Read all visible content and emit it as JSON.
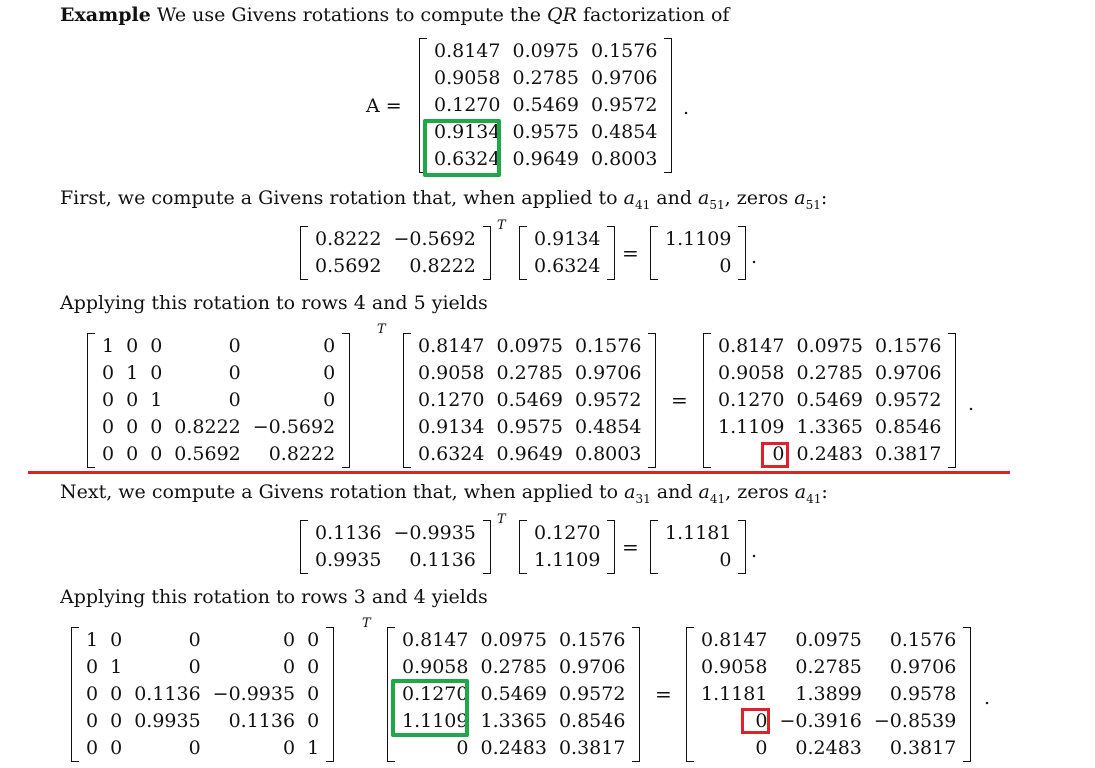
{
  "intro": {
    "bold": "Example",
    "text": " We use Givens rotations to compute the ",
    "qr": "QR",
    "tail": " factorization of"
  },
  "A": {
    "label": "A =",
    "rows": [
      [
        "0.8147",
        "0.0975",
        "0.1576"
      ],
      [
        "0.9058",
        "0.2785",
        "0.9706"
      ],
      [
        "0.1270",
        "0.5469",
        "0.9572"
      ],
      [
        "0.9134",
        "0.9575",
        "0.4854"
      ],
      [
        "0.6324",
        "0.9649",
        "0.8003"
      ]
    ]
  },
  "step1": {
    "text": "First, we compute a Givens rotation that, when applied to ",
    "a1": "a",
    "s1": "41",
    "mid": " and ",
    "a2": "a",
    "s2": "51",
    "tail": ", zeros ",
    "a3": "a",
    "s3": "51",
    "end": ":"
  },
  "g1": {
    "G": [
      [
        "0.8222",
        "−0.5692"
      ],
      [
        "0.5692",
        "0.8222"
      ]
    ],
    "v": [
      "0.9134",
      "0.6324"
    ],
    "r": [
      "1.1109",
      "0"
    ]
  },
  "apply1": "Applying this rotation to rows 4 and 5 yields",
  "eq1": {
    "Q": [
      [
        "1",
        "0",
        "0",
        "0",
        "0"
      ],
      [
        "0",
        "1",
        "0",
        "0",
        "0"
      ],
      [
        "0",
        "0",
        "1",
        "0",
        "0"
      ],
      [
        "0",
        "0",
        "0",
        "0.8222",
        "−0.5692"
      ],
      [
        "0",
        "0",
        "0",
        "0.5692",
        "0.8222"
      ]
    ],
    "A": [
      [
        "0.8147",
        "0.0975",
        "0.1576"
      ],
      [
        "0.9058",
        "0.2785",
        "0.9706"
      ],
      [
        "0.1270",
        "0.5469",
        "0.9572"
      ],
      [
        "0.9134",
        "0.9575",
        "0.4854"
      ],
      [
        "0.6324",
        "0.9649",
        "0.8003"
      ]
    ],
    "R": [
      [
        "0.8147",
        "0.0975",
        "0.1576"
      ],
      [
        "0.9058",
        "0.2785",
        "0.9706"
      ],
      [
        "0.1270",
        "0.5469",
        "0.9572"
      ],
      [
        "1.1109",
        "1.3365",
        "0.8546"
      ],
      [
        "0",
        "0.2483",
        "0.3817"
      ]
    ]
  },
  "step2": {
    "text": "Next, we compute a Givens rotation that, when applied to ",
    "a1": "a",
    "s1": "31",
    "mid": " and ",
    "a2": "a",
    "s2": "41",
    "tail": ", zeros ",
    "a3": "a",
    "s3": "41",
    "end": ":"
  },
  "g2": {
    "G": [
      [
        "0.1136",
        "−0.9935"
      ],
      [
        "0.9935",
        "0.1136"
      ]
    ],
    "v": [
      "0.1270",
      "1.1109"
    ],
    "r": [
      "1.1181",
      "0"
    ]
  },
  "apply2": "Applying this rotation to rows 3 and 4 yields",
  "eq2": {
    "Q": [
      [
        "1",
        "0",
        "0",
        "0",
        "0"
      ],
      [
        "0",
        "1",
        "0",
        "0",
        "0"
      ],
      [
        "0",
        "0",
        "0.1136",
        "−0.9935",
        "0"
      ],
      [
        "0",
        "0",
        "0.9935",
        "0.1136",
        "0"
      ],
      [
        "0",
        "0",
        "0",
        "0",
        "1"
      ]
    ],
    "A": [
      [
        "0.8147",
        "0.0975",
        "0.1576"
      ],
      [
        "0.9058",
        "0.2785",
        "0.9706"
      ],
      [
        "0.1270",
        "0.5469",
        "0.9572"
      ],
      [
        "1.1109",
        "1.3365",
        "0.8546"
      ],
      [
        "0",
        "0.2483",
        "0.3817"
      ]
    ],
    "R": [
      [
        "0.8147",
        "0.0975",
        "0.1576"
      ],
      [
        "0.9058",
        "0.2785",
        "0.9706"
      ],
      [
        "1.1181",
        "1.3899",
        "0.9578"
      ],
      [
        "0",
        "−0.3916",
        "−0.8539"
      ],
      [
        "0",
        "0.2483",
        "0.3817"
      ]
    ]
  },
  "sym": {
    "T": "T",
    "eq": "=",
    "dot": "."
  }
}
